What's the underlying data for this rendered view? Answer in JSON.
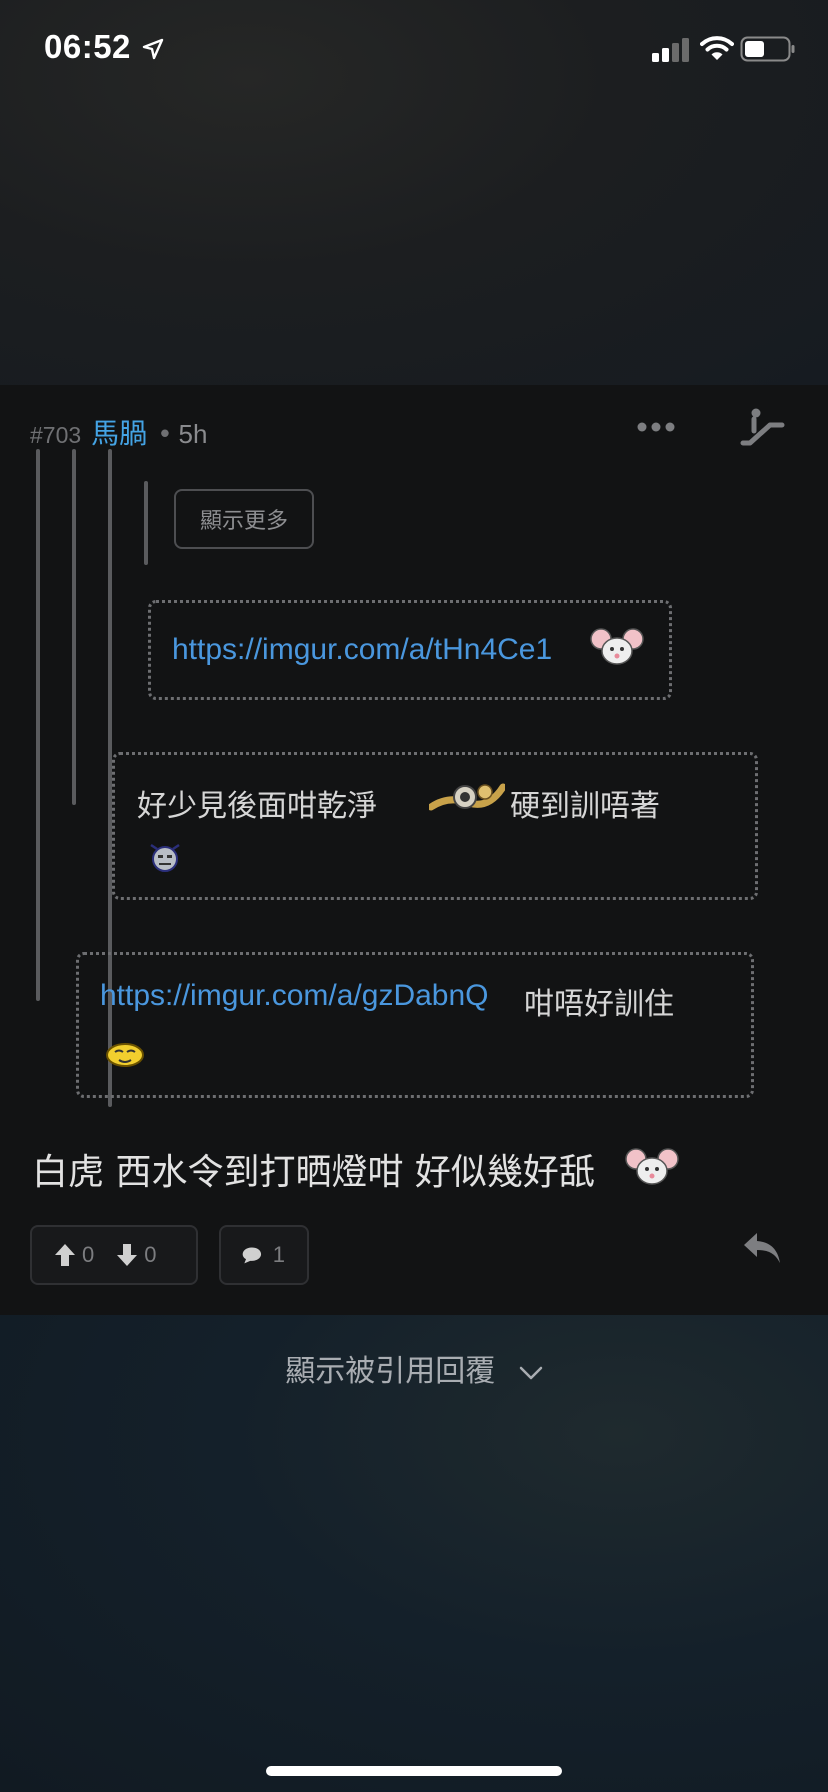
{
  "status_bar": {
    "time": "06:52"
  },
  "post": {
    "number": "#703",
    "author": "馬腡",
    "separator": "•",
    "time_ago": "5h",
    "show_more_label": "顯示更多",
    "quotes": [
      {
        "link": "https://imgur.com/a/tHn4Ce1",
        "text": ""
      },
      {
        "text_before": "好少見後面咁乾淨",
        "text_after": "硬到訓唔著"
      },
      {
        "link": "https://imgur.com/a/gzDabnQ",
        "text": "咁唔好訓住"
      }
    ],
    "body": "白虎 西水令到打晒燈咁 好似幾好舐",
    "upvotes": "0",
    "downvotes": "0",
    "comments": "1"
  },
  "footer": {
    "show_quoted_label": "顯示被引用回覆"
  },
  "colors": {
    "author": "#44a3e4",
    "link": "#4a97de",
    "card_bg": "#121314"
  }
}
